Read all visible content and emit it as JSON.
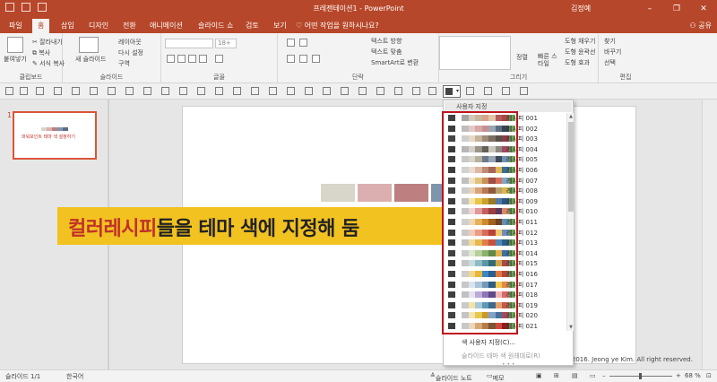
{
  "app": {
    "title": "프레젠테이션1 - PowerPoint",
    "user": "김정예",
    "window_buttons": [
      "–",
      "❐",
      "✕"
    ]
  },
  "tabs": [
    {
      "label": "파일",
      "active": false
    },
    {
      "label": "홈",
      "active": true
    },
    {
      "label": "삽입",
      "active": false
    },
    {
      "label": "디자인",
      "active": false
    },
    {
      "label": "전환",
      "active": false
    },
    {
      "label": "애니메이션",
      "active": false
    },
    {
      "label": "슬라이드 쇼",
      "active": false
    },
    {
      "label": "검토",
      "active": false
    },
    {
      "label": "보기",
      "active": false
    }
  ],
  "tell_me": "♡ 어떤 작업을 원하시나요?",
  "share": "공유",
  "ribbon": {
    "clipboard": {
      "label": "클립보드",
      "paste": "붙여넣기",
      "cut": "잘라내기",
      "copy": "복사",
      "format_painter": "서식 복사"
    },
    "slides": {
      "label": "슬라이드",
      "new_slide": "새 슬라이드",
      "layout": "레이아웃",
      "reset": "다시 설정",
      "section": "구역"
    },
    "font": {
      "label": "글꼴",
      "font_size": "18+"
    },
    "paragraph": {
      "label": "단락",
      "text_direction": "텍스트 방향",
      "align_text": "텍스트 맞춤",
      "smartart": "SmartArt로 변환"
    },
    "drawing": {
      "label": "그리기",
      "arrange": "정렬",
      "quick_styles": "빠른 스타일",
      "shape_fill": "도형 채우기",
      "shape_outline": "도형 윤곽선",
      "shape_effects": "도형 효과"
    },
    "editing": {
      "label": "편집",
      "find": "찾기",
      "replace": "바꾸기",
      "select": "선택"
    }
  },
  "left_pane": {
    "slide_number": "1",
    "thumb_text": "파워포인트 테마 색 설정하기"
  },
  "slide": {
    "swatches": [
      "#d8d5cb",
      "#dbafaf",
      "#bd7f80",
      "#7e95ad"
    ],
    "caption_part1": "컬러레시피",
    "caption_part2": "들을 테마 색에 지정해 둠",
    "caption_color": "#f2c220"
  },
  "dropdown": {
    "header": "사용자 지정",
    "items": [
      {
        "name": "레시피 001",
        "colors": [
          "#404040",
          "#ffffff",
          "#a5a5a5",
          "#d0c9b8",
          "#c9b59e",
          "#d8a38d",
          "#e3c6a8",
          "#b45b5b",
          "#a94747",
          "#6aa84f"
        ]
      },
      {
        "name": "레시피 002",
        "colors": [
          "#3d3d3d",
          "#ffffff",
          "#bdbdbd",
          "#e6c7c7",
          "#d6a7a7",
          "#c98f8f",
          "#9aa5b1",
          "#5c6f82",
          "#36444f",
          "#74a85c"
        ]
      },
      {
        "name": "레시피 003",
        "colors": [
          "#444444",
          "#ffffff",
          "#cfcfcf",
          "#e7d9c4",
          "#c4b39a",
          "#9f8c76",
          "#7b6f62",
          "#5a5046",
          "#8c3b4a",
          "#73a65d"
        ]
      },
      {
        "name": "레시피 004",
        "colors": [
          "#3a3a3a",
          "#ffffff",
          "#b6b6b6",
          "#d4d0c6",
          "#9a9489",
          "#64615b",
          "#c9c6bd",
          "#8e8a81",
          "#a54862",
          "#6fa35b"
        ]
      },
      {
        "name": "레시피 005",
        "colors": [
          "#404040",
          "#ffffff",
          "#c8c8c8",
          "#d7d6c7",
          "#b7b1a0",
          "#6c7a89",
          "#98a6b6",
          "#3e4a59",
          "#7090b0",
          "#6da85a"
        ]
      },
      {
        "name": "레시피 006",
        "colors": [
          "#3c3c3c",
          "#ffffff",
          "#d1d1d1",
          "#e9ddd0",
          "#dcb8a3",
          "#bd8c74",
          "#a4665a",
          "#e2b85a",
          "#3f6d8e",
          "#6ba657"
        ]
      },
      {
        "name": "레시피 007",
        "colors": [
          "#3e3e3e",
          "#ffffff",
          "#bfbfbf",
          "#f0e2c8",
          "#e0c27a",
          "#c88f5a",
          "#9b4f46",
          "#d86f5c",
          "#84a4c4",
          "#6aa656"
        ]
      },
      {
        "name": "레시피 008",
        "colors": [
          "#424242",
          "#ffffff",
          "#cccccc",
          "#e8d2b6",
          "#d6a37c",
          "#b9784f",
          "#8b5a3c",
          "#b9a06a",
          "#d9b64c",
          "#70a95a"
        ]
      },
      {
        "name": "레시피 009",
        "colors": [
          "#3b3b3b",
          "#ffffff",
          "#c2c2c2",
          "#f5e6a8",
          "#e8c44a",
          "#c9a22d",
          "#9a7b1f",
          "#4f7ba6",
          "#2f5680",
          "#6da756"
        ]
      },
      {
        "name": "레시피 010",
        "colors": [
          "#404040",
          "#ffffff",
          "#c6c6c6",
          "#f1d5d5",
          "#e09a9a",
          "#c75f5f",
          "#9b3f3f",
          "#5e3a5a",
          "#d88a6a",
          "#6aa554"
        ]
      },
      {
        "name": "레시피 011",
        "colors": [
          "#3d3d3d",
          "#ffffff",
          "#cfcfcf",
          "#efd9b4",
          "#e6b35a",
          "#d08a2e",
          "#a3621c",
          "#6b4424",
          "#5f8fb4",
          "#6ca757"
        ]
      },
      {
        "name": "레시피 012",
        "colors": [
          "#3f3f3f",
          "#ffffff",
          "#c9c9c9",
          "#f3c9b8",
          "#ea9c86",
          "#d86b58",
          "#b8443a",
          "#f0c76c",
          "#6c8eb8",
          "#6fa85a"
        ]
      },
      {
        "name": "레시피 013",
        "colors": [
          "#3a3a3a",
          "#ffffff",
          "#c3c3c3",
          "#f2dc9c",
          "#e4b94f",
          "#dd7d4a",
          "#c8523c",
          "#4e88b7",
          "#2c5f8a",
          "#6aa755"
        ]
      },
      {
        "name": "레시피 014",
        "colors": [
          "#414141",
          "#ffffff",
          "#cbcbcb",
          "#dfe8d1",
          "#b7cf9c",
          "#8db06a",
          "#5f8a4a",
          "#e2b04c",
          "#3b6fa0",
          "#6ea859"
        ]
      },
      {
        "name": "레시피 015",
        "colors": [
          "#3c3c3c",
          "#ffffff",
          "#c5c5c5",
          "#c8dce0",
          "#8fbcc4",
          "#5a98a4",
          "#336c78",
          "#d4a64a",
          "#a84a4a",
          "#6ca656"
        ]
      },
      {
        "name": "레시피 016",
        "colors": [
          "#404040",
          "#ffffff",
          "#cdcdcd",
          "#f4d88a",
          "#e8b73a",
          "#3e86c2",
          "#2b5f91",
          "#e07a3c",
          "#b04a3a",
          "#6ba757"
        ]
      },
      {
        "name": "레시피 017",
        "colors": [
          "#3d3d3d",
          "#ffffff",
          "#c7c7c7",
          "#d9e4ec",
          "#a9c3d8",
          "#7199bb",
          "#2e5d86",
          "#f2c94c",
          "#e08a48",
          "#6ea85a"
        ]
      },
      {
        "name": "레시피 018",
        "colors": [
          "#3f3f3f",
          "#ffffff",
          "#c1c1c1",
          "#e6e0f0",
          "#bba9d6",
          "#8f74b8",
          "#5e4a8c",
          "#f2b6b6",
          "#d86a6a",
          "#6aa655"
        ]
      },
      {
        "name": "레시피 019",
        "colors": [
          "#3b3b3b",
          "#ffffff",
          "#cacaca",
          "#f4e4a4",
          "#a4c8d8",
          "#5e9ab8",
          "#3c6a8e",
          "#e8a06a",
          "#c4584a",
          "#6ca757"
        ]
      },
      {
        "name": "레시피 020",
        "colors": [
          "#424242",
          "#ffffff",
          "#c4c4c4",
          "#f1e5b0",
          "#e7c84d",
          "#c79a2e",
          "#7ea3c7",
          "#4a6f9a",
          "#a44a5a",
          "#6fa95a"
        ]
      },
      {
        "name": "레시피 021",
        "colors": [
          "#3e3e3e",
          "#ffffff",
          "#c8c8c8",
          "#ead7c0",
          "#d7a874",
          "#b57d4a",
          "#7b5536",
          "#d04a3a",
          "#8e1e1e",
          "#6ba656"
        ]
      }
    ],
    "footer_primary": "색 사용자 지정(C)...",
    "footer_secondary": "슬라이드 테마 색 원래대로(R)"
  },
  "copyright": "Copyright ⓒ. 2016. Jeong ye Kim. All right reserved.",
  "status": {
    "slide": "슬라이드 1/1",
    "language": "한국어",
    "notes": "슬라이드 노트",
    "comments": "메모",
    "zoom": "68 %"
  }
}
